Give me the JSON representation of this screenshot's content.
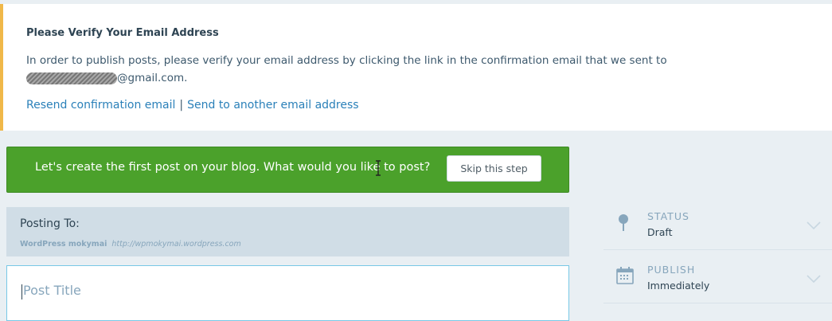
{
  "notice": {
    "title": "Please Verify Your Email Address",
    "body": "In order to publish posts, please verify your email address by clicking the link in the confirmation email that we sent to",
    "email_suffix": "@gmail.com.",
    "resend_link": "Resend confirmation email",
    "separator": "|",
    "send_other_link": "Send to another email address",
    "accent_color": "#f0b849"
  },
  "onboarding": {
    "message": "Let's create the first post on your blog. What would you like to post?",
    "skip_label": "Skip this step",
    "bar_color": "#4ba12b"
  },
  "posting_to": {
    "label": "Posting To:",
    "site_name": "WordPress mokymai",
    "site_url": "http://wpmokymai.wordpress.com"
  },
  "editor": {
    "title_placeholder": "Post Title"
  },
  "sidebar": {
    "status": {
      "label": "STATUS",
      "value": "Draft",
      "icon": "pin-icon"
    },
    "publish": {
      "label": "PUBLISH",
      "value": "Immediately",
      "icon": "calendar-icon"
    }
  }
}
